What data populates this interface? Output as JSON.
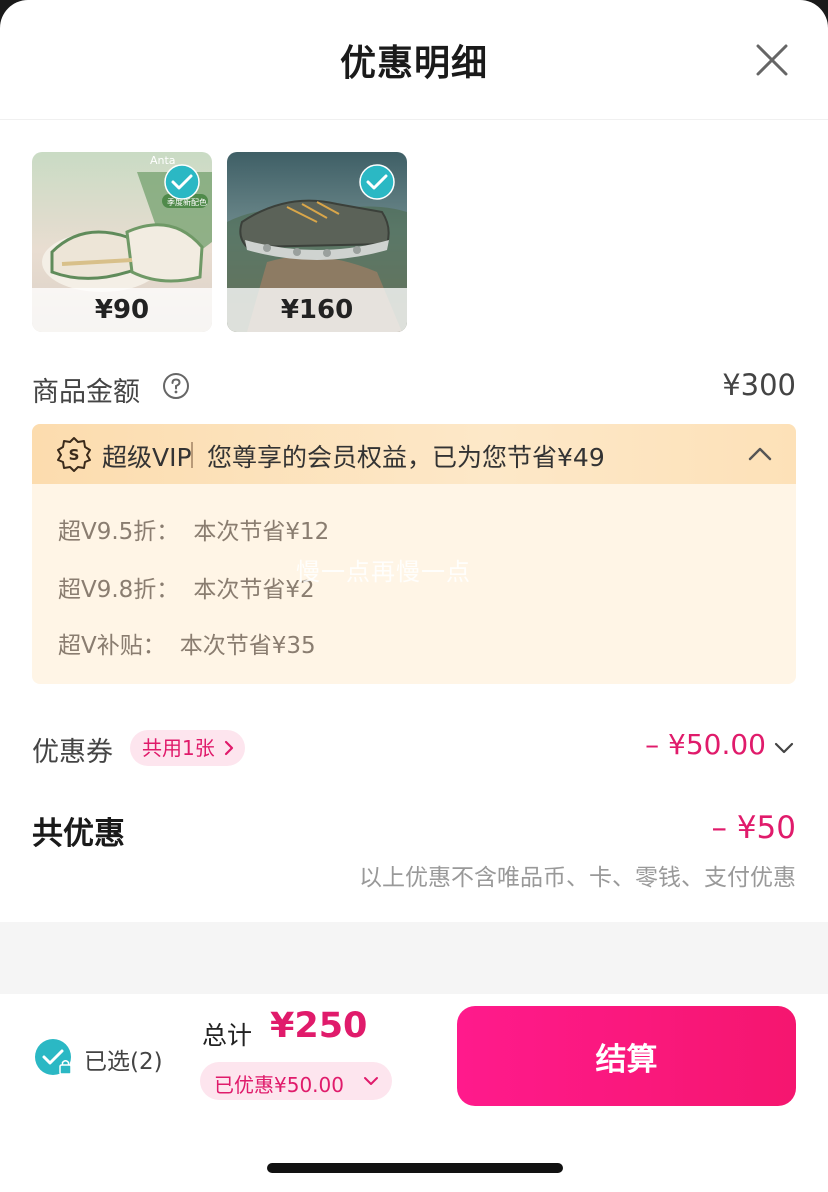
{
  "header": {
    "title": "优惠明细",
    "close_icon": "close-icon"
  },
  "products": [
    {
      "price": "¥90",
      "selected": true,
      "check_icon": "check-circle-icon"
    },
    {
      "price": "¥160",
      "selected": true,
      "check_icon": "check-circle-icon"
    }
  ],
  "goods_amount": {
    "label": "商品金额",
    "help_icon": "question-circle-icon",
    "value": "¥300"
  },
  "vip": {
    "brand": "超级VIP",
    "message": "您尊享的会员权益，已为您节省¥49",
    "expand_icon": "chevron-up-icon",
    "details": [
      {
        "name": "超V9.5折：",
        "saving": "本次节省¥12"
      },
      {
        "name": "超V9.8折：",
        "saving": "本次节省¥2"
      },
      {
        "name": "超V补贴：",
        "saving": "本次节省¥35"
      }
    ],
    "watermark": "慢一点再慢一点"
  },
  "coupon": {
    "label": "优惠券",
    "tag": "共用1张",
    "value": "– ¥50.00"
  },
  "total_discount": {
    "label": "共优惠",
    "value": "– ¥50",
    "note": "以上优惠不含唯品币、卡、零钱、支付优惠"
  },
  "footer": {
    "selected": "已选(2)",
    "total_label": "总计",
    "total_value": "¥250",
    "discount_pill": "已优惠¥50.00",
    "pay_button": "结算"
  },
  "colors": {
    "accent": "#e01b6b",
    "button": "#ff1a8c",
    "check": "#2bb8c4",
    "vip_bg": "#fff5e6"
  }
}
